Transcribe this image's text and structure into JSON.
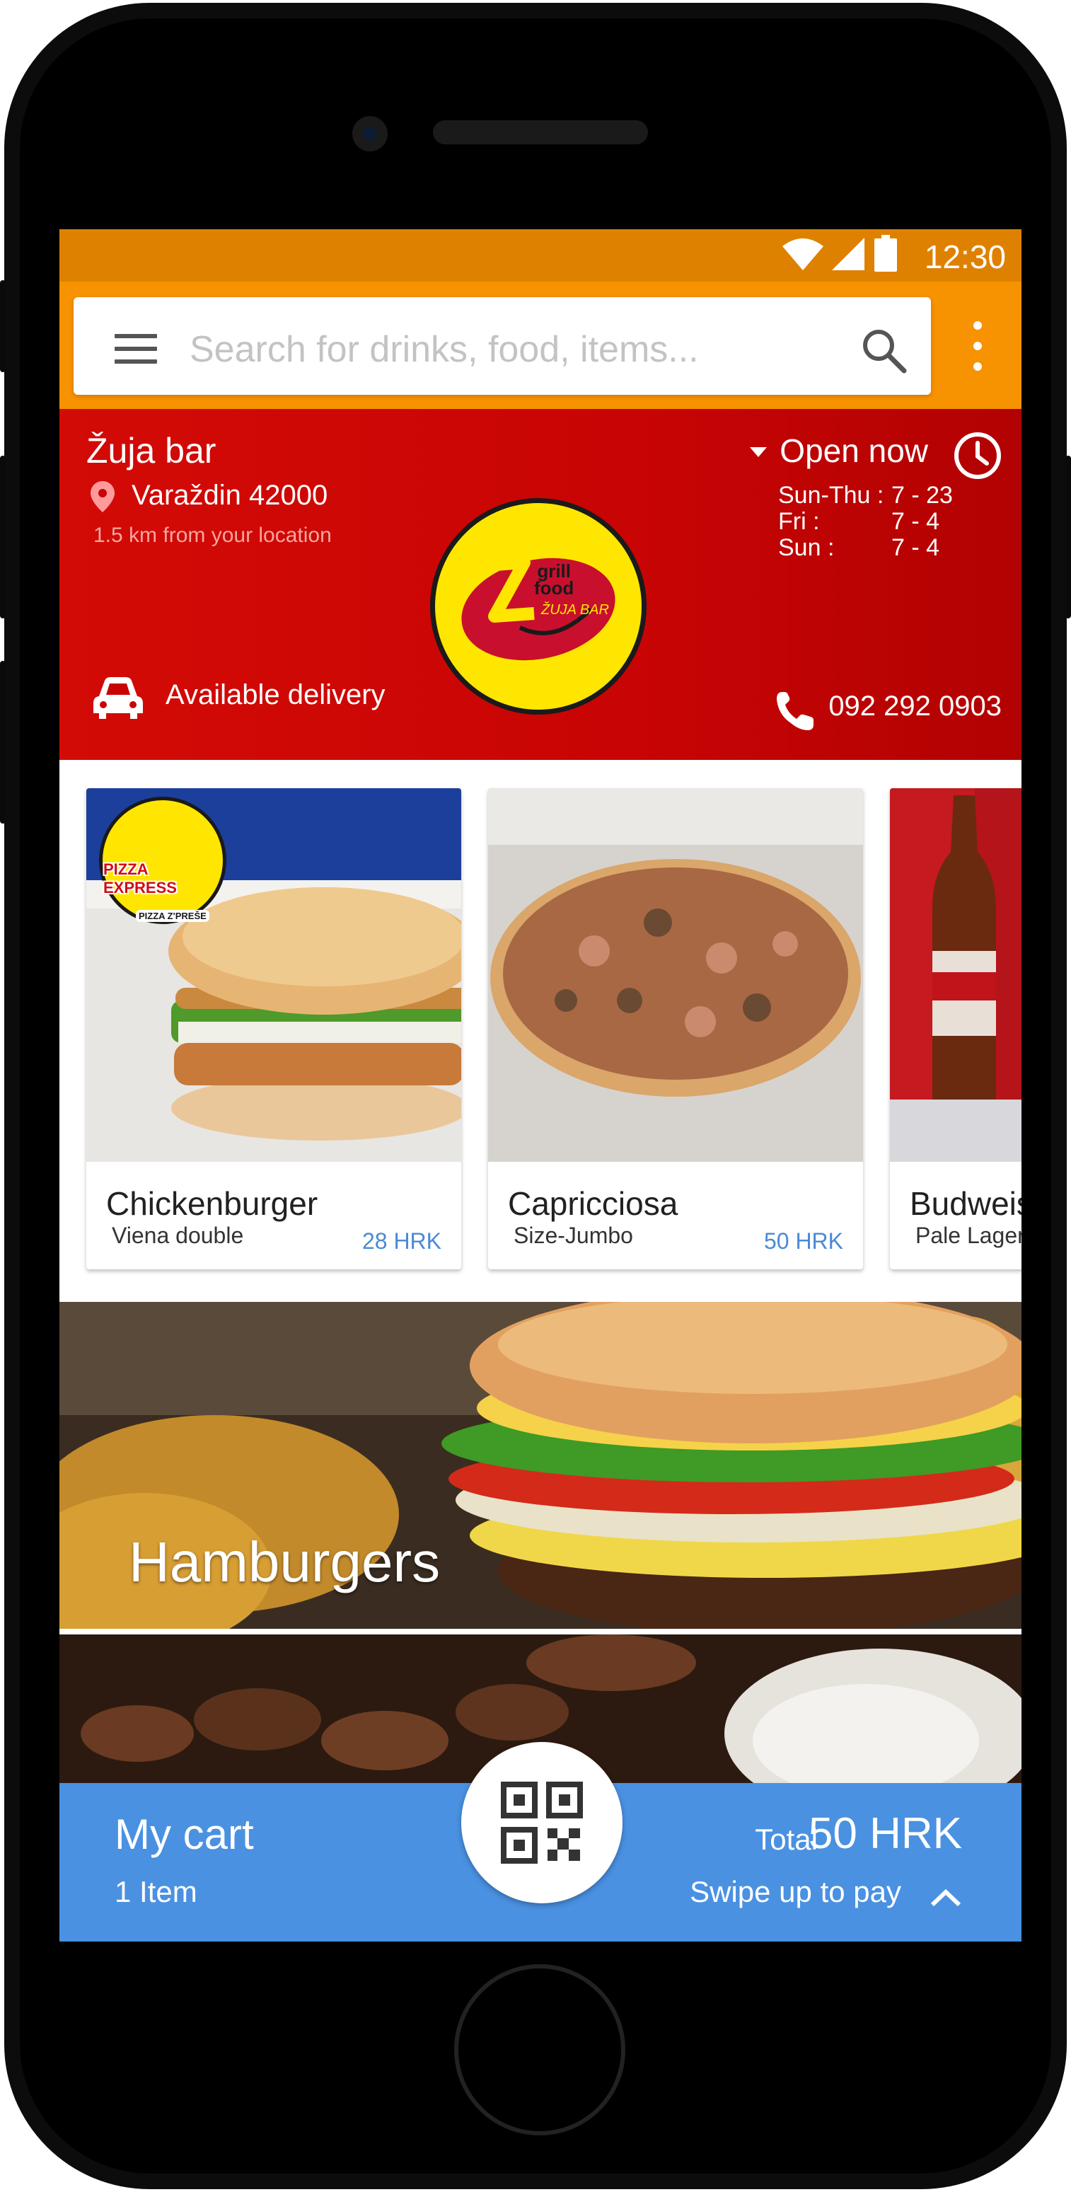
{
  "status_bar": {
    "time": "12:30"
  },
  "search": {
    "placeholder": "Search for drinks, food, items..."
  },
  "header": {
    "bar_name": "Žuja bar",
    "address": "Varaždin 42000",
    "distance": "1.5 km from your location",
    "open_status": "Open now",
    "hours": [
      {
        "day": "Sun-Thu :",
        "time": "7 - 23"
      },
      {
        "day": "Fri :",
        "time": "7 - 4"
      },
      {
        "day": "Sun :",
        "time": "7 - 4"
      }
    ],
    "delivery": "Available delivery",
    "phone": "092 292 0903",
    "logo_text": {
      "line1": "grill",
      "line2": "food",
      "brand": "ŽUJA BAR"
    }
  },
  "featured": [
    {
      "name": "Chickenburger",
      "sub": "Viena double",
      "price": "28 HRK",
      "badge": {
        "top": "PIZZA",
        "mid": "EXPRESS",
        "bottom": "PIZZA Z'PREŠE"
      }
    },
    {
      "name": "Capricciosa",
      "sub": "Size-Jumbo",
      "price": "50 HRK"
    },
    {
      "name": "Budweiser",
      "sub": "Pale Lager",
      "price": ""
    }
  ],
  "categories": [
    {
      "label": "Hamburgers"
    },
    {
      "label": ""
    }
  ],
  "cart": {
    "title": "My cart",
    "count": "1 Item",
    "total_label": "Total",
    "total_value": "50 HRK",
    "swipe_hint": "Swipe up to pay"
  },
  "colors": {
    "status_bar": "#df8100",
    "app_bar": "#f79200",
    "header_red": "#c80404",
    "cart_blue": "#4a91e2",
    "price_blue": "#4a8ad6"
  }
}
